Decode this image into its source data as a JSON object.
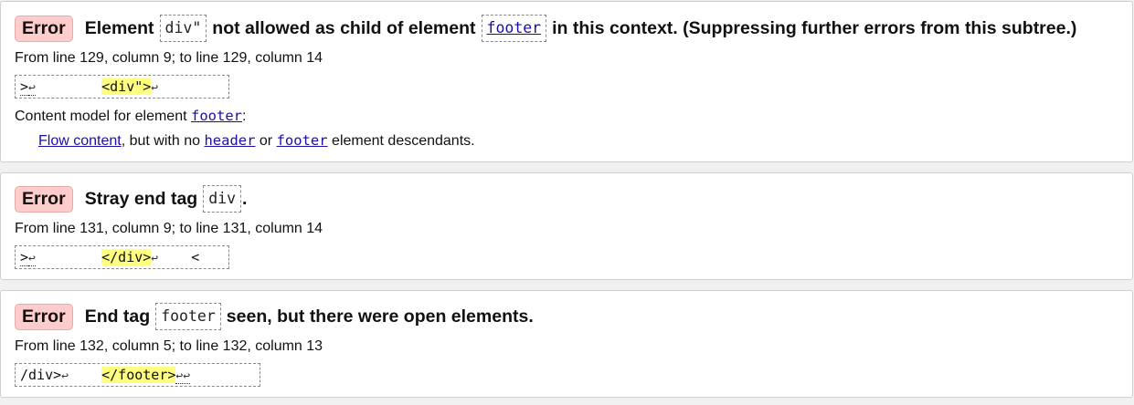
{
  "messages": [
    {
      "badge": "Error",
      "title_parts": [
        "Element",
        "div\"",
        "not allowed as child of element",
        "footer",
        "in this context. (Suppressing further errors from this subtree.)"
      ],
      "location": "From line 129, column 9; to line 129, column 14",
      "extract": {
        "before": ">",
        "before_ret": "↩",
        "gap": "        ",
        "highlight": "<div\">",
        "after_ret": "↩"
      },
      "content_model": {
        "label": "Content model for element",
        "element": "footer",
        "colon": ":",
        "link": "Flow content",
        "middle": ", but with no",
        "el1": "header",
        "or": "or",
        "el2": "footer",
        "tail": "element descendants."
      }
    },
    {
      "badge": "Error",
      "title_parts": [
        "Stray end tag",
        "div",
        "."
      ],
      "location": "From line 131, column 9; to line 131, column 14",
      "extract": {
        "before": ">",
        "before_ret": "↩",
        "gap": "        ",
        "highlight": "</div>",
        "after_ret": "↩",
        "after": "    <"
      }
    },
    {
      "badge": "Error",
      "title_parts": [
        "End tag",
        "footer",
        "seen, but there were open elements."
      ],
      "location": "From line 132, column 5; to line 132, column 13",
      "extract": {
        "before": "/div>",
        "before_ret": "↩",
        "gap": "    ",
        "highlight": "</footer>",
        "after_ret": "↩↩"
      }
    }
  ],
  "colors": {
    "error_badge_bg": "#ffcccc",
    "highlight_bg": "#ffff80",
    "link": "#1a0dab"
  }
}
